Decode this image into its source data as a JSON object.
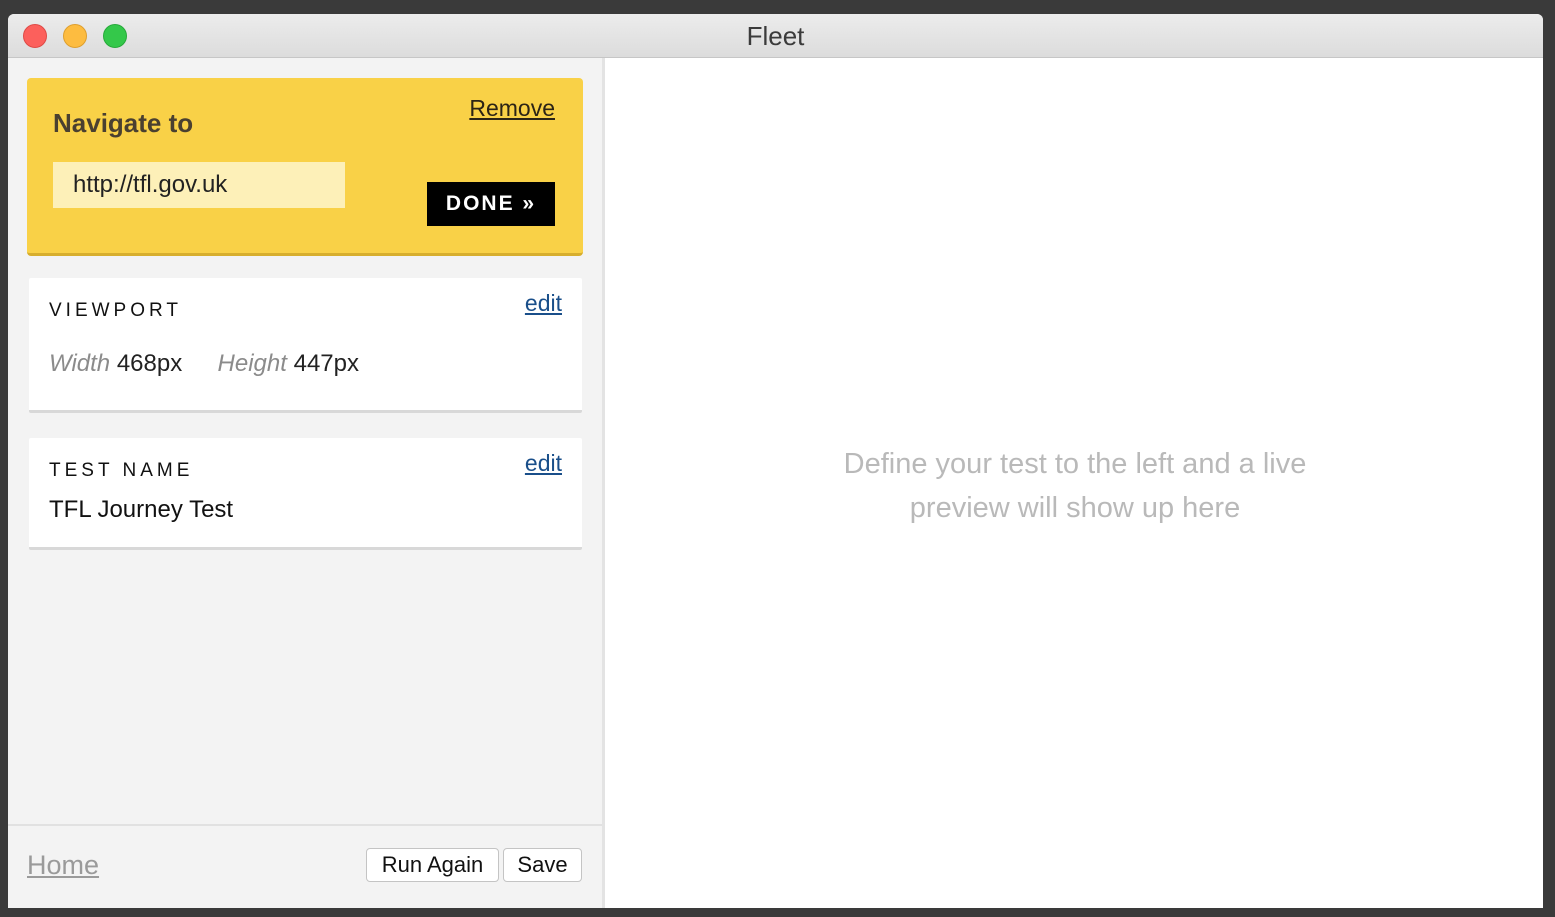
{
  "window": {
    "title": "Fleet"
  },
  "nav_card": {
    "title": "Navigate to",
    "remove_label": "Remove",
    "url_value": "http://tfl.gov.uk",
    "done_label": "DONE »"
  },
  "viewport_card": {
    "heading": "VIEWPORT",
    "edit_label": "edit",
    "width_label": "Width",
    "width_value": "468px",
    "height_label": "Height",
    "height_value": "447px"
  },
  "test_name_card": {
    "heading": "TEST NAME",
    "edit_label": "edit",
    "value": "TFL Journey Test"
  },
  "footer": {
    "home_label": "Home",
    "run_again_label": "Run Again",
    "save_label": "Save"
  },
  "preview": {
    "message": "Define your test to the left and a live preview will show up here"
  },
  "colors": {
    "nav_card_bg": "#f9d147",
    "done_button_bg": "#000000",
    "link_blue": "#1a4f8a",
    "preview_text": "#b9b9b9"
  }
}
